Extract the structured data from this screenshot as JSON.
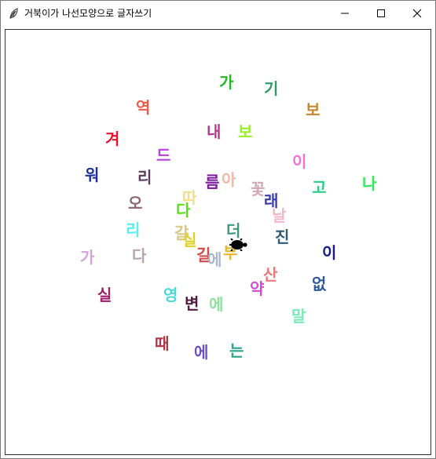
{
  "window": {
    "title": "거북이가 나선모양으로 글자쓰기",
    "icons": {
      "app": "feather-icon",
      "minimize": "minimize-icon",
      "maximize": "maximize-icon",
      "close": "close-icon"
    }
  },
  "canvas": {
    "turtle": {
      "icon": "turtle-icon",
      "color": "#000000"
    },
    "words": [
      {
        "text": "가",
        "color": "#22b922"
      },
      {
        "text": "기",
        "color": "#2f9a63"
      },
      {
        "text": "역",
        "color": "#ec5a4a"
      },
      {
        "text": "보",
        "color": "#c8872c"
      },
      {
        "text": "내",
        "color": "#b2398e"
      },
      {
        "text": "보",
        "color": "#99ee2a"
      },
      {
        "text": "겨",
        "color": "#e8122f"
      },
      {
        "text": "드",
        "color": "#b542e2"
      },
      {
        "text": "이",
        "color": "#f170d4"
      },
      {
        "text": "워",
        "color": "#1d2e9a"
      },
      {
        "text": "리",
        "color": "#5e3b5d"
      },
      {
        "text": "름",
        "color": "#7a1c9c"
      },
      {
        "text": "아",
        "color": "#f2b8a5"
      },
      {
        "text": "꽃",
        "color": "#d0a8b4"
      },
      {
        "text": "고",
        "color": "#29cc86"
      },
      {
        "text": "나",
        "color": "#32e85a"
      },
      {
        "text": "오",
        "color": "#8c6570"
      },
      {
        "text": "따",
        "color": "#f2dd88"
      },
      {
        "text": "래",
        "color": "#3a3ab0"
      },
      {
        "text": "다",
        "color": "#58e01a"
      },
      {
        "text": "날",
        "color": "#f2b6c8"
      },
      {
        "text": "리",
        "color": "#5aeeee"
      },
      {
        "text": "갈",
        "color": "#d9c882"
      },
      {
        "text": "실",
        "color": "#e0d026"
      },
      {
        "text": "더",
        "color": "#3c9a7a"
      },
      {
        "text": "진",
        "color": "#2b5a72"
      },
      {
        "text": "이",
        "color": "#161c8c"
      },
      {
        "text": "가",
        "color": "#d3a3da"
      },
      {
        "text": "다",
        "color": "#b8a3b5"
      },
      {
        "text": "길",
        "color": "#d14a4a"
      },
      {
        "text": "에",
        "color": "#a7b6c8"
      },
      {
        "text": "부",
        "color": "#e4b92f"
      },
      {
        "text": "산",
        "color": "#eb7a7a"
      },
      {
        "text": "없",
        "color": "#2e5a9c"
      },
      {
        "text": "실",
        "color": "#9c1d6a"
      },
      {
        "text": "영",
        "color": "#4bd8d6"
      },
      {
        "text": "변",
        "color": "#521a40"
      },
      {
        "text": "에",
        "color": "#8fe29e"
      },
      {
        "text": "약",
        "color": "#d44ad4"
      },
      {
        "text": "말",
        "color": "#7aeab9"
      },
      {
        "text": "때",
        "color": "#a83a48"
      },
      {
        "text": "에",
        "color": "#6a50c2"
      },
      {
        "text": "는",
        "color": "#2aa48a"
      }
    ]
  }
}
